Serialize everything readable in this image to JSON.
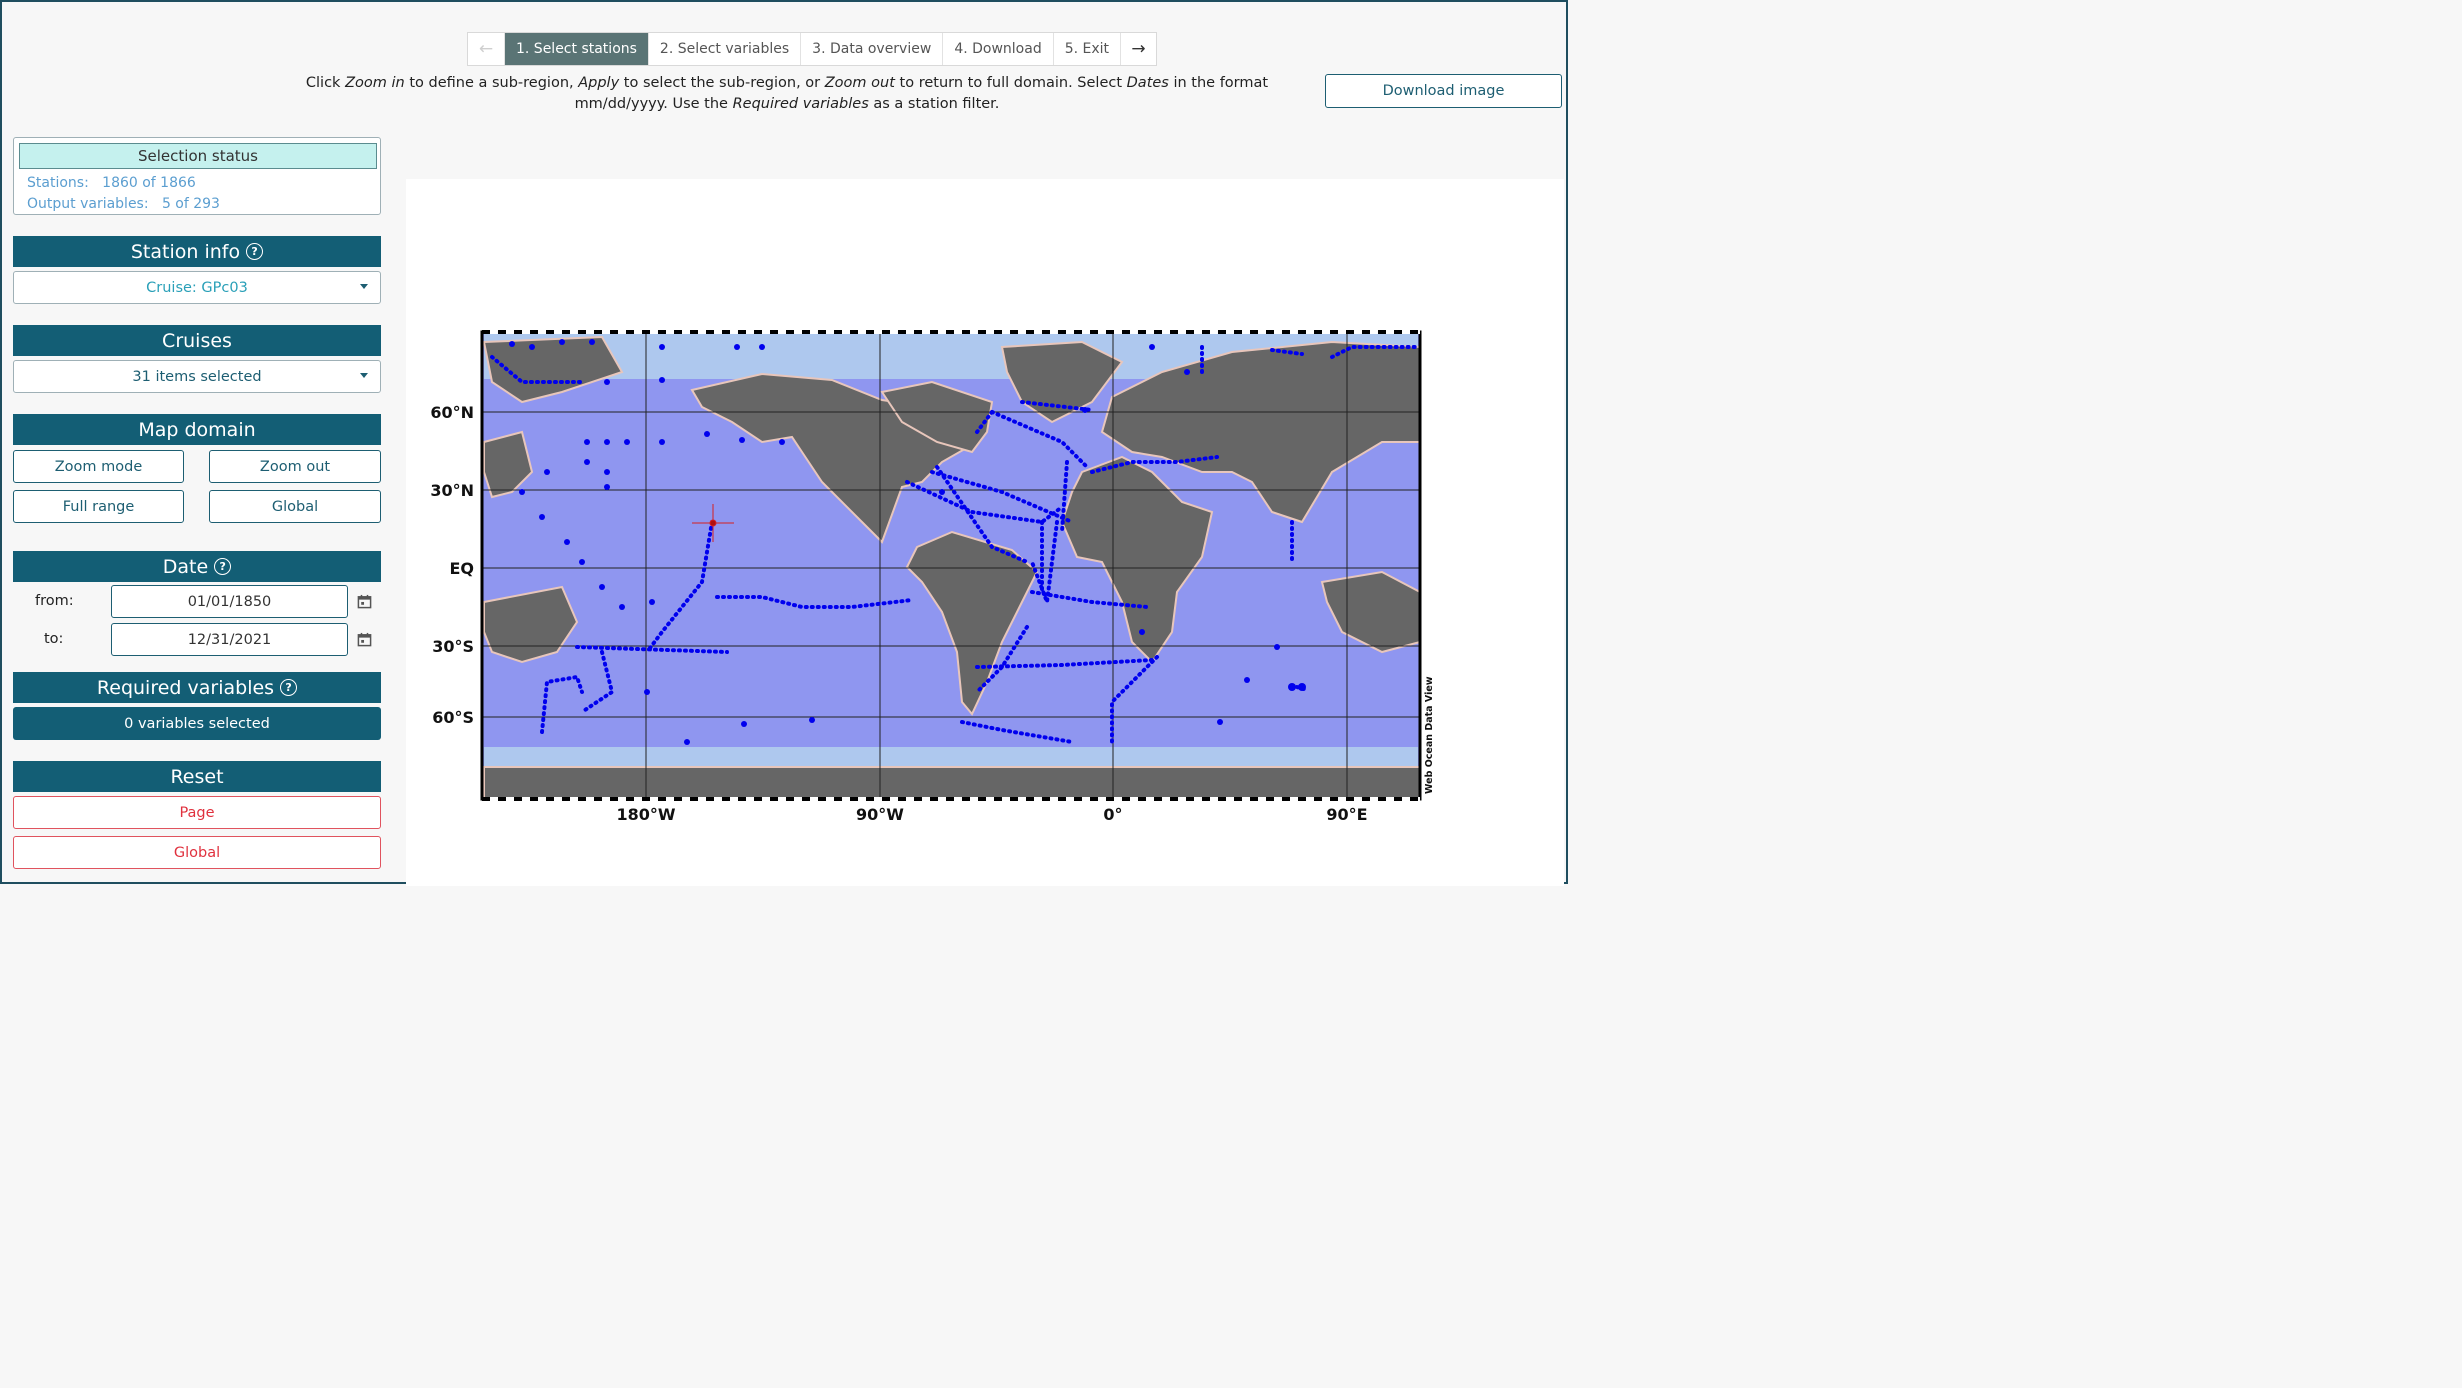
{
  "steps": {
    "back_icon": "arrow-left-icon",
    "items": [
      "1. Select stations",
      "2. Select variables",
      "3. Data overview",
      "4. Download",
      "5. Exit"
    ],
    "forward_icon": "arrow-right-icon"
  },
  "instructions": {
    "p1": "Click ",
    "zoom_in": "Zoom in",
    "p2": " to define a sub-region, ",
    "apply": "Apply",
    "p3": " to select the sub-region, or ",
    "zoom_out": "Zoom out",
    "p4": " to return to full domain. Select ",
    "dates": "Dates",
    "p5": " in the format mm/dd/yyyy. Use the ",
    "required": "Required variables",
    "p6": " as a station filter."
  },
  "download_image": "Download image",
  "status": {
    "title": "Selection status",
    "stations_label": "Stations:",
    "stations_value": "1860 of 1866",
    "vars_label": "Output variables:",
    "vars_value": "5 of 293"
  },
  "station_info": {
    "title": "Station info",
    "dropdown": "Cruise: GPc03"
  },
  "cruises": {
    "title": "Cruises",
    "dropdown": "31 items selected"
  },
  "map_domain": {
    "title": "Map domain",
    "zoom_mode": "Zoom mode",
    "zoom_out": "Zoom out",
    "full_range": "Full range",
    "global": "Global"
  },
  "date": {
    "title": "Date",
    "from_label": "from:",
    "from_value": "01/01/1850",
    "to_label": "to:",
    "to_value": "12/31/2021"
  },
  "required_variables": {
    "title": "Required variables",
    "value": "0 variables selected"
  },
  "reset": {
    "title": "Reset",
    "page": "Page",
    "global": "Global"
  },
  "map": {
    "lat_labels": [
      "60°N",
      "30°N",
      "EQ",
      "30°S",
      "60°S"
    ],
    "lon_labels": [
      "180°W",
      "90°W",
      "0°",
      "90°E"
    ],
    "watermark": "Web Ocean Data View"
  },
  "colors": {
    "accent": "#135e75",
    "active_step": "#5a7475",
    "station_dots": "#0000ee",
    "land": "#666666",
    "ocean": "#8f96f0",
    "reset": "#e0313e"
  }
}
